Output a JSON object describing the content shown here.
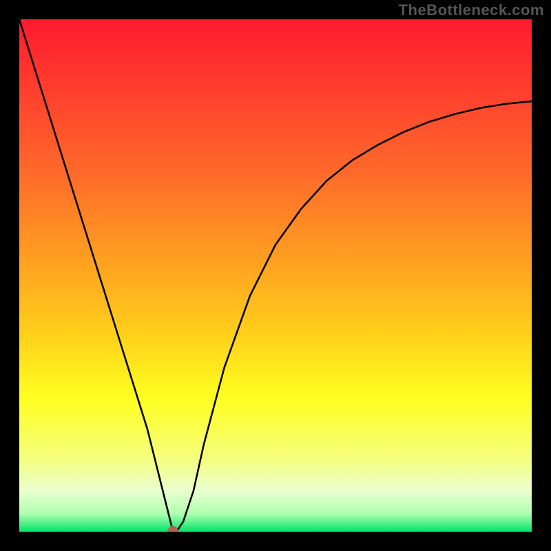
{
  "watermark": "TheBottleneck.com",
  "colors": {
    "frame": "#000000",
    "curve": "#000000",
    "marker": "#c05a4a",
    "gradient_stops": [
      {
        "offset": 0.0,
        "color": "#ff1a2e"
      },
      {
        "offset": 0.12,
        "color": "#ff3a2e"
      },
      {
        "offset": 0.3,
        "color": "#ff6a2a"
      },
      {
        "offset": 0.48,
        "color": "#ffa320"
      },
      {
        "offset": 0.62,
        "color": "#ffd21a"
      },
      {
        "offset": 0.74,
        "color": "#ffff20"
      },
      {
        "offset": 0.86,
        "color": "#f4ff80"
      },
      {
        "offset": 0.92,
        "color": "#eaffd0"
      },
      {
        "offset": 0.965,
        "color": "#b0ffb0"
      },
      {
        "offset": 1.0,
        "color": "#00e56a"
      }
    ]
  },
  "chart_data": {
    "type": "line",
    "title": "",
    "xlabel": "",
    "ylabel": "",
    "xlim": [
      0,
      100
    ],
    "ylim": [
      0,
      100
    ],
    "note": "Axes are unlabeled; values are estimated in percent of plot width/height with origin at bottom-left.",
    "series": [
      {
        "name": "curve",
        "color": "#000000",
        "x": [
          0,
          5,
          10,
          15,
          20,
          25,
          27,
          29,
          30,
          31,
          32,
          34,
          36,
          40,
          45,
          50,
          55,
          60,
          65,
          70,
          75,
          80,
          85,
          90,
          95,
          100
        ],
        "y": [
          100,
          84,
          68,
          52,
          36,
          20,
          12,
          4,
          0,
          0.5,
          2,
          8,
          17,
          32,
          46,
          56,
          63,
          68.5,
          72.5,
          75.5,
          78,
          80,
          81.5,
          82.7,
          83.5,
          84
        ]
      }
    ],
    "marker": {
      "x": 30,
      "y": 0,
      "color": "#c05a4a",
      "radius_px": 8
    }
  }
}
